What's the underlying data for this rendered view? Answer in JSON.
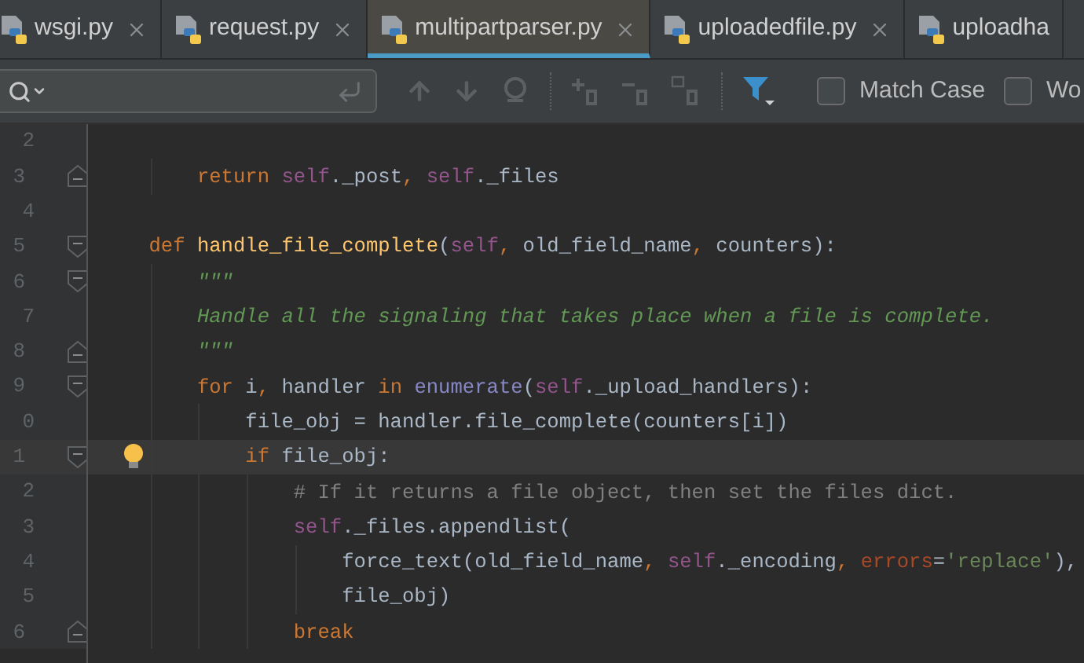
{
  "tabs": [
    {
      "label": "wsgi.py",
      "selected": false,
      "closable": true
    },
    {
      "label": "request.py",
      "selected": false,
      "closable": true
    },
    {
      "label": "multipartparser.py",
      "selected": true,
      "closable": true
    },
    {
      "label": "uploadedfile.py",
      "selected": false,
      "closable": true
    },
    {
      "label": "uploadha",
      "selected": false,
      "closable": false
    }
  ],
  "find_bar": {
    "options": [
      {
        "label": "Match Case",
        "checked": false
      },
      {
        "label": "Wo",
        "checked": false
      }
    ]
  },
  "editor": {
    "lines": [
      {
        "number": "2",
        "fold_start": false,
        "fold_end": false,
        "current": false,
        "bulb": false
      },
      {
        "number": "3",
        "fold_start": false,
        "fold_end": true,
        "current": false,
        "bulb": false,
        "tokens": [
          {
            "t": "        return ",
            "kind": "kw"
          },
          {
            "t": "self",
            "kind": "self"
          },
          {
            "t": "._post",
            "kind": "plain"
          },
          {
            "t": ", ",
            "kind": "punct"
          },
          {
            "t": "self",
            "kind": "self"
          },
          {
            "t": "._files",
            "kind": "plain"
          }
        ]
      },
      {
        "number": "4",
        "fold_start": false,
        "fold_end": false,
        "current": false,
        "bulb": false
      },
      {
        "number": "5",
        "fold_start": true,
        "fold_end": false,
        "current": false,
        "bulb": false,
        "tokens": [
          {
            "t": "    def ",
            "kind": "kw"
          },
          {
            "t": "handle_file_complete",
            "kind": "fn"
          },
          {
            "t": "(",
            "kind": "plain"
          },
          {
            "t": "self",
            "kind": "self"
          },
          {
            "t": ", ",
            "kind": "punct"
          },
          {
            "t": "old_field_name",
            "kind": "plain"
          },
          {
            "t": ", ",
            "kind": "punct"
          },
          {
            "t": "counters):",
            "kind": "plain"
          }
        ]
      },
      {
        "number": "6",
        "fold_start": true,
        "fold_end": false,
        "current": false,
        "bulb": false,
        "tokens": [
          {
            "t": "        \"\"\"",
            "kind": "doc"
          }
        ]
      },
      {
        "number": "7",
        "fold_start": false,
        "fold_end": false,
        "current": false,
        "bulb": false,
        "tokens": [
          {
            "t": "        Handle all the signaling that takes place when a file is complete.",
            "kind": "doc"
          }
        ]
      },
      {
        "number": "8",
        "fold_start": false,
        "fold_end": true,
        "current": false,
        "bulb": false,
        "tokens": [
          {
            "t": "        \"\"\"",
            "kind": "doc"
          }
        ]
      },
      {
        "number": "9",
        "fold_start": true,
        "fold_end": false,
        "current": false,
        "bulb": false,
        "tokens": [
          {
            "t": "        for ",
            "kind": "kw"
          },
          {
            "t": "i",
            "kind": "plain"
          },
          {
            "t": ", ",
            "kind": "punct"
          },
          {
            "t": "handler ",
            "kind": "plain"
          },
          {
            "t": "in ",
            "kind": "kw"
          },
          {
            "t": "enumerate",
            "kind": "builtin"
          },
          {
            "t": "(",
            "kind": "plain"
          },
          {
            "t": "self",
            "kind": "self"
          },
          {
            "t": "._upload_handlers):",
            "kind": "plain"
          }
        ]
      },
      {
        "number": "0",
        "fold_start": false,
        "fold_end": false,
        "current": false,
        "bulb": false,
        "tokens": [
          {
            "t": "            file_obj = handler.file_complete(counters[i])",
            "kind": "plain"
          }
        ]
      },
      {
        "number": "1",
        "fold_start": true,
        "fold_end": false,
        "current": true,
        "bulb": true,
        "tokens": [
          {
            "t": "            if ",
            "kind": "kw"
          },
          {
            "t": "file_obj:",
            "kind": "plain"
          }
        ]
      },
      {
        "number": "2",
        "fold_start": false,
        "fold_end": false,
        "current": false,
        "bulb": false,
        "tokens": [
          {
            "t": "                # If it returns a file object, then set the files dict.",
            "kind": "comment"
          }
        ]
      },
      {
        "number": "3",
        "fold_start": false,
        "fold_end": false,
        "current": false,
        "bulb": false,
        "tokens": [
          {
            "t": "                self",
            "kind": "self"
          },
          {
            "t": "._files.appendlist(",
            "kind": "plain"
          }
        ]
      },
      {
        "number": "4",
        "fold_start": false,
        "fold_end": false,
        "current": false,
        "bulb": false,
        "tokens": [
          {
            "t": "                    force_text(old_field_name",
            "kind": "plain"
          },
          {
            "t": ", ",
            "kind": "punct"
          },
          {
            "t": "self",
            "kind": "self"
          },
          {
            "t": "._encoding",
            "kind": "plain"
          },
          {
            "t": ", ",
            "kind": "punct"
          },
          {
            "t": "errors",
            "kind": "named"
          },
          {
            "t": "=",
            "kind": "plain"
          },
          {
            "t": "'replace'",
            "kind": "str"
          },
          {
            "t": "),",
            "kind": "plain"
          }
        ]
      },
      {
        "number": "5",
        "fold_start": false,
        "fold_end": false,
        "current": false,
        "bulb": false,
        "tokens": [
          {
            "t": "                    file_obj)",
            "kind": "plain"
          }
        ]
      },
      {
        "number": "6",
        "fold_start": false,
        "fold_end": true,
        "current": false,
        "bulb": false,
        "tokens": [
          {
            "t": "                break",
            "kind": "kw"
          }
        ]
      }
    ]
  }
}
